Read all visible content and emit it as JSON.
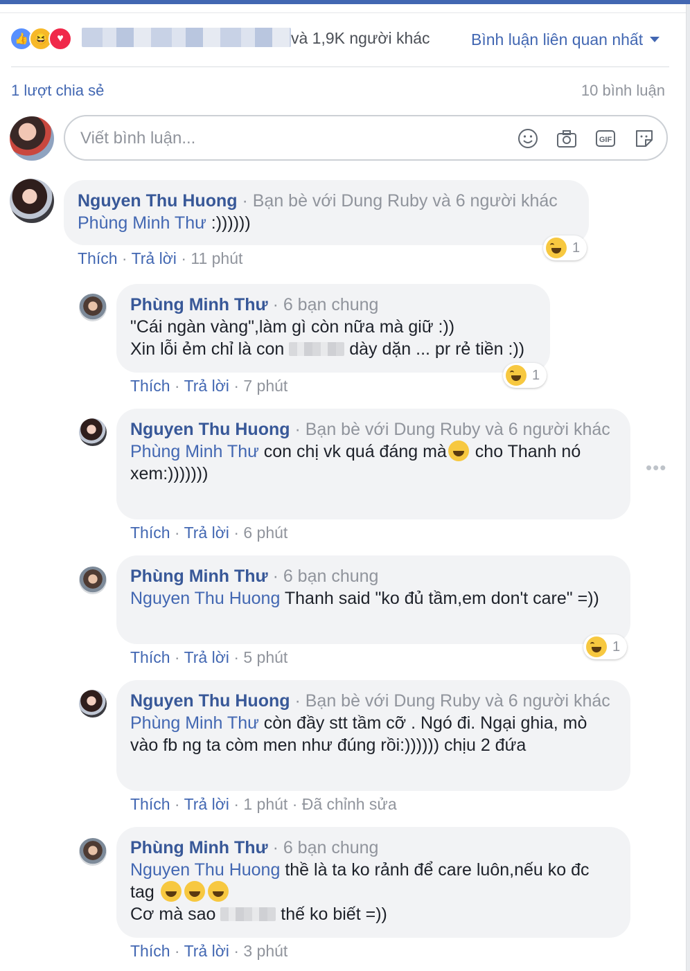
{
  "reactions_bar": {
    "others_text": "và 1,9K người khác",
    "sort_label": "Bình luận liên quan nhất"
  },
  "stats": {
    "shares": "1 lượt chia sẻ",
    "comments": "10 bình luận"
  },
  "composer": {
    "placeholder": "Viết bình luận..."
  },
  "actions": {
    "like": "Thích",
    "reply": "Trả lời",
    "sep": "·"
  },
  "comments": [
    {
      "author": "Nguyen Thu Huong",
      "meta": "· Bạn bè với Dung Ruby và 6 người khác",
      "mention": "Phùng Minh Thư",
      "text": ":))))))",
      "time": "11 phút",
      "reaction_count": "1"
    },
    {
      "author": "Phùng Minh Thư",
      "meta": "· 6 bạn chung",
      "line1": "\"Cái ngàn vàng\",làm gì còn nữa mà giữ :))",
      "line2a": "Xin lỗi ẻm chỉ là con",
      "line2b": "dày dặn ... pr rẻ tiền :))",
      "time": "7 phút",
      "reaction_count": "1"
    },
    {
      "author": "Nguyen Thu Huong",
      "meta": "· Bạn bè với Dung Ruby và 6 người khác",
      "mention": "Phùng Minh Thư",
      "text_a": "con chị vk quá đáng mà",
      "text_b": "cho Thanh nó xem:)))))))",
      "time": "6 phút"
    },
    {
      "author": "Phùng Minh Thư",
      "meta": "· 6 bạn chung",
      "mention": "Nguyen Thu Huong",
      "text": "Thanh said \"ko đủ tầm,em don't care\" =))",
      "time": "5 phút",
      "reaction_count": "1"
    },
    {
      "author": "Nguyen Thu Huong",
      "meta": "· Bạn bè với Dung Ruby và 6 người khác",
      "mention": "Phùng Minh Thư",
      "text": "còn đầy stt tầm cỡ . Ngó đi. Ngại ghia, mò vào fb ng ta còm men như đúng rồi:)))))) chịu 2 đứa",
      "time": "1 phút",
      "edited": "· Đã chỉnh sửa"
    },
    {
      "author": "Phùng Minh Thư",
      "meta": "· 6 bạn chung",
      "mention": "Nguyen Thu Huong",
      "text": "thề là ta ko rảnh để care luôn,nếu ko đc tag",
      "line2a": "Cơ mà sao",
      "line2b": "thế ko biết =))",
      "time": "3 phút"
    }
  ],
  "more_menu": "•••"
}
